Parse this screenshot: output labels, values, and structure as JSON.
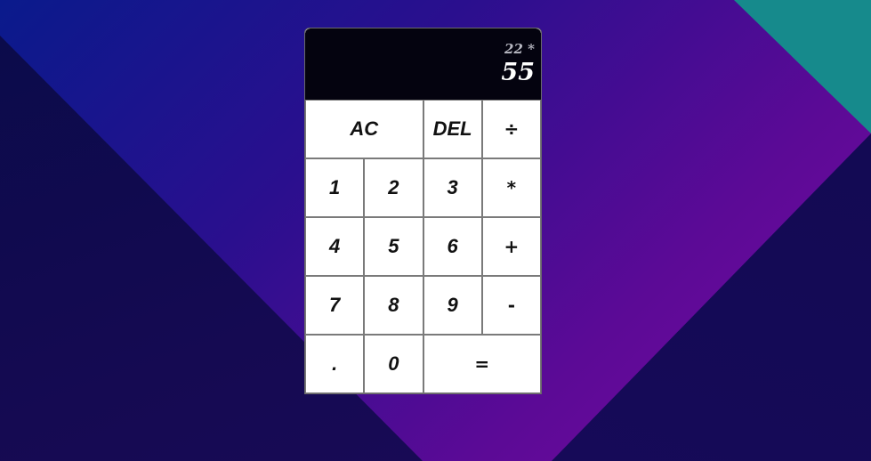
{
  "display": {
    "previous": "22 *",
    "current": "55"
  },
  "keys": {
    "ac": "AC",
    "del": "DEL",
    "divide": "÷",
    "one": "1",
    "two": "2",
    "three": "3",
    "multiply": "*",
    "four": "4",
    "five": "5",
    "six": "6",
    "plus": "+",
    "seven": "7",
    "eight": "8",
    "nine": "9",
    "minus": "-",
    "dot": ".",
    "zero": "0",
    "equals": "="
  },
  "colors": {
    "display_bg": "#04030f",
    "key_bg": "#ffffff",
    "teal_accent": "#168a8c"
  }
}
